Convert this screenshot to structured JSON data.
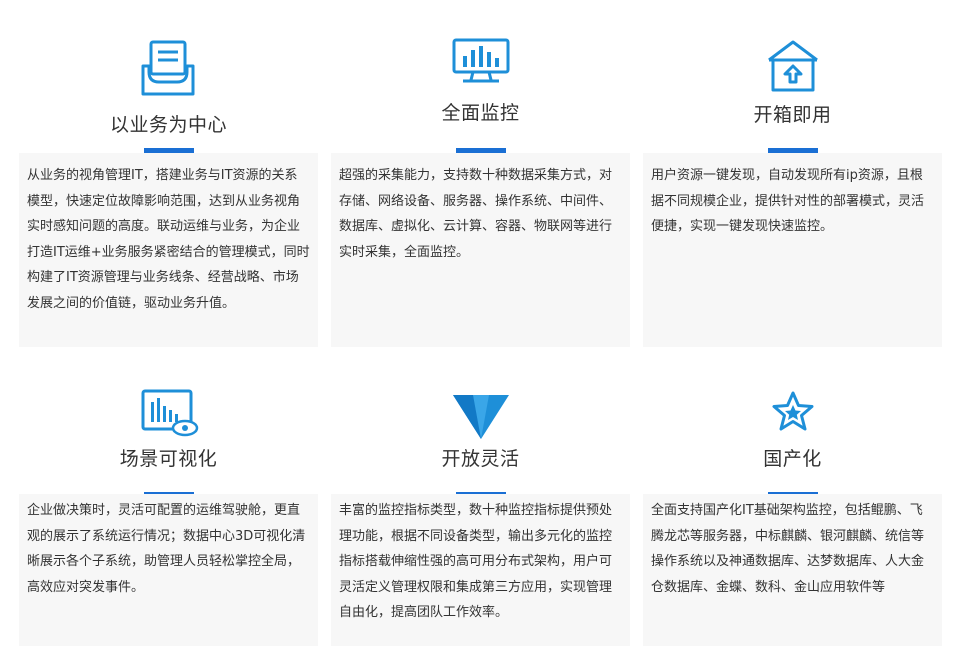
{
  "features": [
    {
      "icon": "inbox-tray-icon",
      "title": "以业务为中心",
      "description": "从业务的视角管理IT，搭建业务与IT资源的关系模型，快速定位故障影响范围，达到从业务视角实时感知问题的高度。联动运维与业务，为企业打造IT运维+业务服务紧密结合的管理模式，同时构建了IT资源管理与业务线条、经营战略、市场发展之间的价值链，驱动业务升值。"
    },
    {
      "icon": "monitor-chart-icon",
      "title": "全面监控",
      "description": "超强的采集能力，支持数十种数据采集方式，对存储、网络设备、服务器、操作系统、中间件、数据库、虚拟化、云计算、容器、物联网等进行实时采集，全面监控。"
    },
    {
      "icon": "box-upload-icon",
      "title": "开箱即用",
      "description": "用户资源一键发现，自动发现所有ip资源，且根据不同规模企业，提供针对性的部署模式，灵活便捷，实现一键发现快速监控。"
    },
    {
      "icon": "chart-eye-icon",
      "title": "场景可视化",
      "description": "企业做决策时，灵活可配置的运维驾驶舱，更直观的展示了系统运行情况；数据中心3D可视化清晰展示各个子系统，助管理人员轻松掌控全局，高效应对突发事件。"
    },
    {
      "icon": "triangle-prism-icon",
      "title": "开放灵活",
      "description": "丰富的监控指标类型，数十种监控指标提供预处理功能，根据不同设备类型，输出多元化的监控指标搭载伸缩性强的高可用分布式架构，用户可灵活定义管理权限和集成第三方应用，实现管理自由化，提高团队工作效率。"
    },
    {
      "icon": "star-badge-icon",
      "title": "国产化",
      "description": "全面支持国产化IT基础架构监控，包括鲲鹏、飞腾龙芯等服务器，中标麒麟、银河麒麟、统信等操作系统以及神通数据库、达梦数据库、人大金仓数据库、金蝶、数科、金山应用软件等"
    }
  ],
  "colors": {
    "accent": "#1a6fd4",
    "icon": "#1e8fd8",
    "panel_bg": "#f7f7f7",
    "text": "#333333"
  }
}
